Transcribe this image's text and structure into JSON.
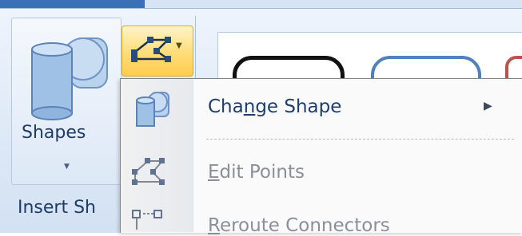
{
  "ribbon": {
    "shapes_button": {
      "label": "Shapes",
      "icon": "shapes-icon"
    },
    "group_label": "Insert Sh",
    "edit_shape_button": {
      "icon": "edit-shape-icon"
    },
    "gallery": {
      "icon": "shape-style-gallery"
    }
  },
  "menu": {
    "items": [
      {
        "label_pre": "Cha",
        "accel": "n",
        "label_post": "ge Shape",
        "icon": "change-shape-icon",
        "state": "enabled",
        "has_submenu": true
      },
      {
        "label_pre": "",
        "accel": "E",
        "label_post": "dit Points",
        "icon": "edit-points-icon",
        "state": "disabled"
      },
      {
        "label_pre": "",
        "accel": "R",
        "label_post": "eroute Connectors",
        "icon": "reroute-connectors-icon",
        "state": "disabled"
      }
    ]
  },
  "colors": {
    "ribbon_bg": "#dde8f6",
    "highlight": "#ffdc76",
    "menu_text": "#1e3e6e",
    "disabled_text": "#8a8f98"
  }
}
